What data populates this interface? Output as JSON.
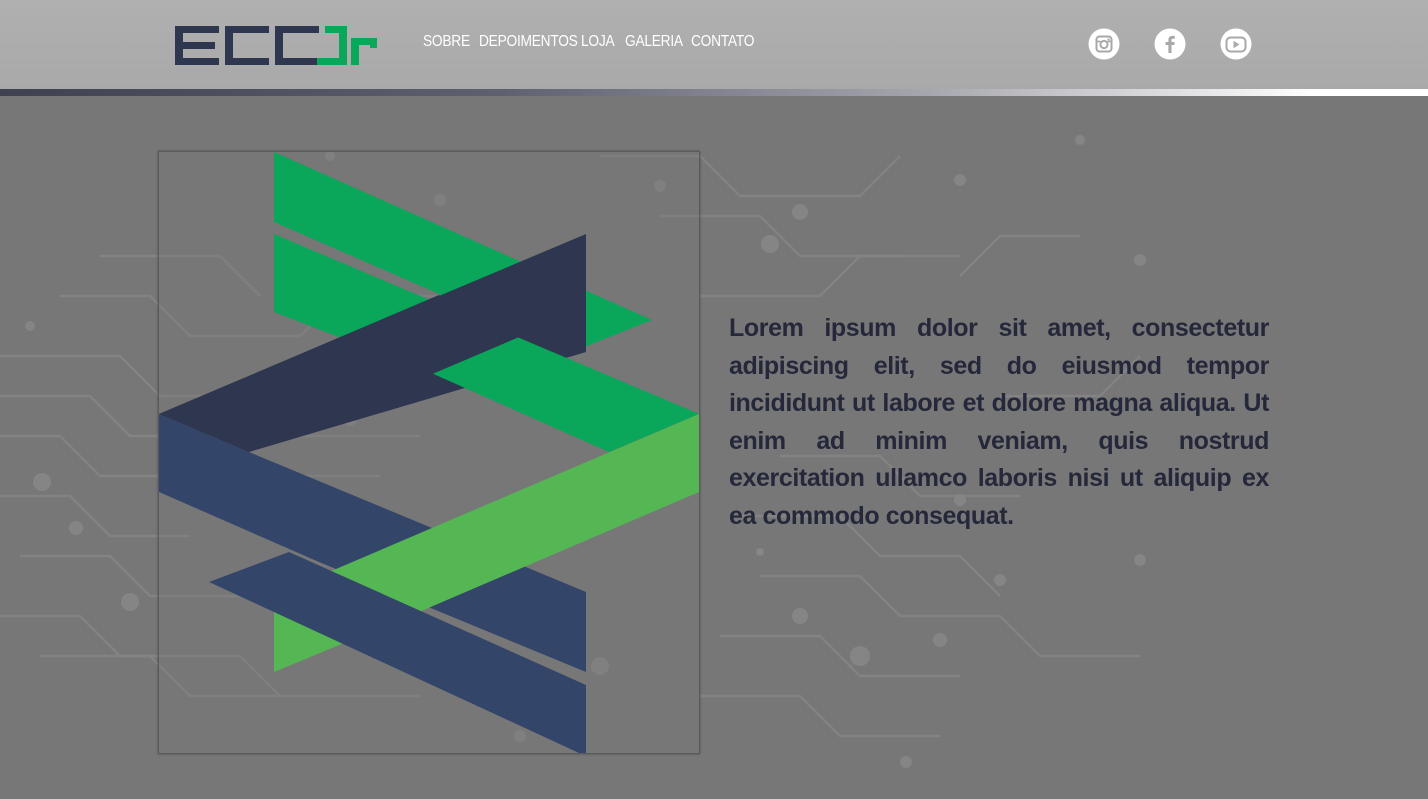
{
  "brand": {
    "logo_text": "ECC Jr",
    "colors": {
      "navy": "#2e3650",
      "green": "#0aa65a",
      "light_green": "#55b753",
      "blue": "#34456a"
    }
  },
  "nav": {
    "items": [
      {
        "label": "SOBRE"
      },
      {
        "label": "DEPOIMENTOS"
      },
      {
        "label": "LOJA"
      },
      {
        "label": "GALERIA"
      },
      {
        "label": "CONTATO"
      }
    ]
  },
  "social": {
    "icons": [
      "instagram-icon",
      "facebook-icon",
      "youtube-icon"
    ]
  },
  "main": {
    "paragraph": "Lorem ipsum dolor sit amet, consectetur adipiscing elit, sed do eiusmod tempor incididunt ut labore et dolore magna aliqua. Ut enim ad minim veniam, quis nostrud exercitation ullamco laboris nisi ut aliquip ex ea commodo consequat."
  }
}
